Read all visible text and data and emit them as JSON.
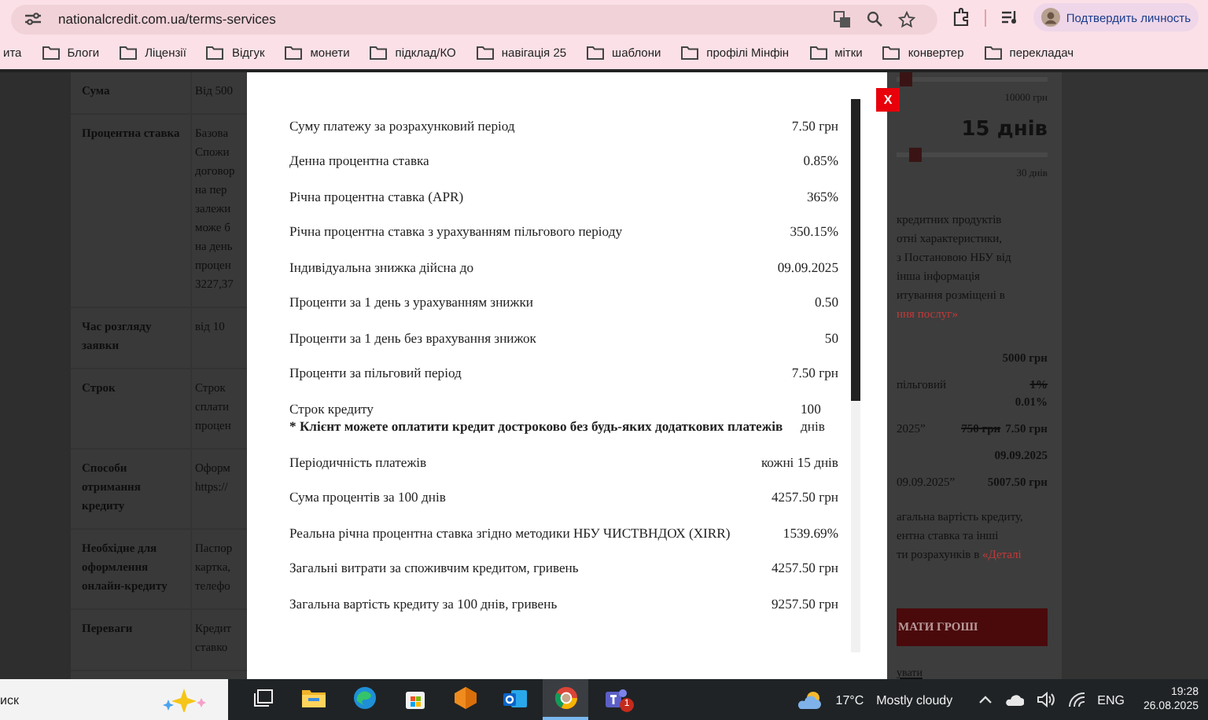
{
  "browser": {
    "url": "nationalcredit.com.ua/terms-services",
    "profile_label": "Подтвердить личность",
    "bookmarks": [
      {
        "kind": "link",
        "label": "ита"
      },
      {
        "kind": "folder",
        "label": "Блоги"
      },
      {
        "kind": "folder",
        "label": "Ліцензії"
      },
      {
        "kind": "folder",
        "label": "Відгук"
      },
      {
        "kind": "folder",
        "label": "монети"
      },
      {
        "kind": "folder",
        "label": "підклад/КО"
      },
      {
        "kind": "folder",
        "label": "навігація 25"
      },
      {
        "kind": "folder",
        "label": "шаблони"
      },
      {
        "kind": "folder",
        "label": "профілі Мінфін"
      },
      {
        "kind": "folder",
        "label": "мітки"
      },
      {
        "kind": "folder",
        "label": "конвертер"
      },
      {
        "kind": "folder",
        "label": "перекладач"
      }
    ]
  },
  "page_table": [
    {
      "label": "Сума",
      "values": [
        "Від 500"
      ]
    },
    {
      "label": "Процентна ставка",
      "values": [
        "Базова",
        "Спожи",
        "договор",
        "на пер",
        "залежи",
        "може б",
        "на день",
        "процен",
        "3227,37"
      ]
    },
    {
      "label": "Час розгляду заявки",
      "values": [
        "від 10"
      ]
    },
    {
      "label": "Строк",
      "values": [
        "Строк",
        "сплати",
        "процен"
      ]
    },
    {
      "label": "Способи отримання кредиту",
      "values": [
        "Оформ",
        "https://"
      ]
    },
    {
      "label": "Необхідне для оформлення онлайн-кредиту",
      "values": [
        "Паспор",
        "картка,",
        "телефо"
      ]
    },
    {
      "label": "Переваги",
      "values": [
        "Кредит",
        "ставко"
      ]
    }
  ],
  "side_panel": {
    "amount_slider": {
      "level": 0.06,
      "max_label": "10000 грн"
    },
    "term": "15 днів",
    "term_slider": {
      "level": 0.12,
      "max_label": "30 днів"
    },
    "paragraph_1": [
      {
        "text": "кредитних продуктів"
      },
      {
        "text": "отні характеристики,"
      },
      {
        "text": "з Постановою НБУ від"
      },
      {
        "text": "інша інформація"
      },
      {
        "text": "итування розміщені в"
      },
      {
        "link": "ння послуг»"
      }
    ],
    "summary": [
      {
        "kind": "inline",
        "value": "5000 грн"
      },
      {
        "kind": "stacked",
        "label": "пільговий",
        "old_value": "1%",
        "value": "0.01%"
      },
      {
        "kind": "inline",
        "label": "2025”",
        "old_value": "750 грн",
        "value": "7.50 грн"
      },
      {
        "kind": "inline",
        "value": "09.09.2025"
      },
      {
        "kind": "inline",
        "label": "09.09.2025”",
        "value": "5007.50 грн"
      }
    ],
    "paragraph_2": [
      {
        "text": "агальна вартість кредиту,"
      },
      {
        "text": "ентна ставка та інші"
      },
      {
        "text": "ти розрахунків в ",
        "link": "«Деталі"
      }
    ],
    "button": "МАТИ ГРОШІ",
    "bottom_link": "увати"
  },
  "modal": {
    "close_label": "X",
    "rows": [
      {
        "label": "Суму платежу за розрахунковий період",
        "value": "7.50 грн"
      },
      {
        "label": "Денна процентна ставка",
        "value": "0.85%"
      },
      {
        "label": "Річна процентна ставка (APR)",
        "value": "365%"
      },
      {
        "label": "Річна процентна ставка з урахуванням пільгового періоду",
        "value": "350.15%"
      },
      {
        "label": "Індивідуальна знижка дійсна до",
        "value": "09.09.2025"
      },
      {
        "label": "Проценти за 1 день з урахуванням знижки",
        "value": "0.50"
      },
      {
        "label": "Проценти за 1 день без врахування знижок",
        "value": "50"
      },
      {
        "label": "Проценти за пільговий період",
        "value": "7.50 грн"
      },
      {
        "label": "Строк кредиту",
        "note": "* Клієнт можете оплатити кредит достроково без будь-яких додаткових платежів",
        "value": "100 днів"
      },
      {
        "label": "Періодичність платежів",
        "value": "кожні 15 днів"
      },
      {
        "label": "Сума процентів за 100 днів",
        "value": "4257.50 грн"
      },
      {
        "label": "Реальна річна процентна ставка згідно методики НБУ ЧИСТВНДОХ (XIRR)",
        "value": "1539.69%"
      },
      {
        "label": "Загальні витрати за споживчим кредитом, гривень",
        "value": "4257.50 грн"
      },
      {
        "label": "Загальна вартість кредиту за 100 днів, гривень",
        "value": "9257.50 грн"
      }
    ]
  },
  "taskbar": {
    "search_text": "иск",
    "apps": [
      {
        "kind": "task_view",
        "active": false
      },
      {
        "kind": "folder",
        "active": false
      },
      {
        "kind": "swirl",
        "active": false
      },
      {
        "kind": "bag",
        "active": false
      },
      {
        "kind": "orange",
        "active": false
      },
      {
        "kind": "mail",
        "active": false
      },
      {
        "kind": "round",
        "active": true
      },
      {
        "kind": "people",
        "active": false,
        "badge": "1"
      }
    ],
    "temperature": "17°C",
    "weather": "Mostly cloudy",
    "language": "ENG",
    "time": "19:28",
    "date": "26.08.2025"
  }
}
